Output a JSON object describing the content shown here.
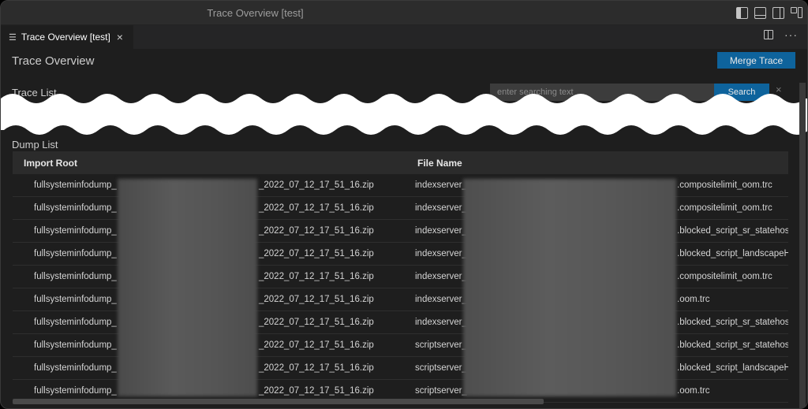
{
  "window": {
    "title": "Trace Overview [test]"
  },
  "tab": {
    "label": "Trace Overview [test]",
    "close": "×",
    "more": "···"
  },
  "page": {
    "title": "Trace Overview",
    "merge_label": "Merge Trace"
  },
  "trace_list": {
    "label": "Trace List",
    "search_placeholder": "enter searching text",
    "search_label": "Search",
    "clear": "×"
  },
  "dump_list": {
    "label": "Dump List",
    "columns": [
      "Import Root",
      "File Name"
    ],
    "rows": [
      {
        "root_prefix": "fullsysteminfodump_",
        "root_suffix": "_2022_07_12_17_51_16.zip",
        "file_prefix": "indexserver_",
        "file_suffix": ".compositelimit_oom.trc"
      },
      {
        "root_prefix": "fullsysteminfodump_",
        "root_suffix": "_2022_07_12_17_51_16.zip",
        "file_prefix": "indexserver_",
        "file_suffix": ".compositelimit_oom.trc"
      },
      {
        "root_prefix": "fullsysteminfodump_",
        "root_suffix": "_2022_07_12_17_51_16.zip",
        "file_prefix": "indexserver_",
        "file_suffix": ".blocked_script_sr_statehostr"
      },
      {
        "root_prefix": "fullsysteminfodump_",
        "root_suffix": "_2022_07_12_17_51_16.zip",
        "file_prefix": "indexserver_",
        "file_suffix": ".blocked_script_landscapeHc"
      },
      {
        "root_prefix": "fullsysteminfodump_",
        "root_suffix": "_2022_07_12_17_51_16.zip",
        "file_prefix": "indexserver_",
        "file_suffix": ".compositelimit_oom.trc"
      },
      {
        "root_prefix": "fullsysteminfodump_",
        "root_suffix": "_2022_07_12_17_51_16.zip",
        "file_prefix": "indexserver_",
        "file_suffix": ".oom.trc"
      },
      {
        "root_prefix": "fullsysteminfodump_",
        "root_suffix": "_2022_07_12_17_51_16.zip",
        "file_prefix": "indexserver_",
        "file_suffix": ".blocked_script_sr_statehostr"
      },
      {
        "root_prefix": "fullsysteminfodump_",
        "root_suffix": "_2022_07_12_17_51_16.zip",
        "file_prefix": "scriptserver_",
        "file_suffix": ".blocked_script_sr_statehostr"
      },
      {
        "root_prefix": "fullsysteminfodump_",
        "root_suffix": "_2022_07_12_17_51_16.zip",
        "file_prefix": "scriptserver_",
        "file_suffix": ".blocked_script_landscapeHc"
      },
      {
        "root_prefix": "fullsysteminfodump_",
        "root_suffix": "_2022_07_12_17_51_16.zip",
        "file_prefix": "scriptserver_",
        "file_suffix": ".oom.trc"
      }
    ]
  },
  "colors": {
    "accent_button": "#0e639c",
    "background": "#1e1e1e",
    "titlebar": "#2c2c2c",
    "header_row": "#2b2b2b"
  }
}
